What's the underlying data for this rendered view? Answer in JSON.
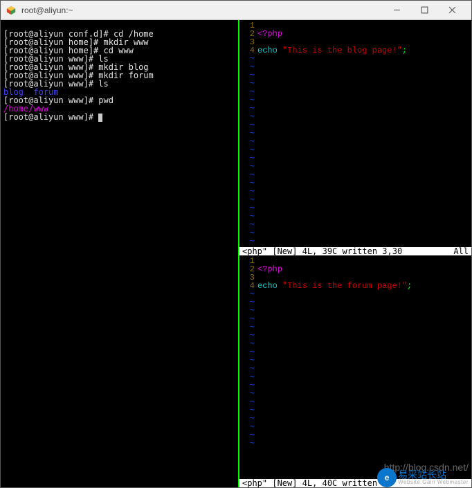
{
  "window": {
    "title": "root@aliyun:~",
    "controls": {
      "minimize": "—",
      "maximize": "☐",
      "close": "✕"
    }
  },
  "shell": {
    "lines": [
      {
        "prompt": "[root@aliyun conf.d]# ",
        "cmd": "cd /home"
      },
      {
        "prompt": "[root@aliyun home]# ",
        "cmd": "mkdir www"
      },
      {
        "prompt": "[root@aliyun home]# ",
        "cmd": "cd www"
      },
      {
        "prompt": "[root@aliyun www]# ",
        "cmd": "ls"
      },
      {
        "prompt": "[root@aliyun www]# ",
        "cmd": "mkdir blog"
      },
      {
        "prompt": "[root@aliyun www]# ",
        "cmd": "mkdir forum"
      },
      {
        "prompt": "[root@aliyun www]# ",
        "cmd": "ls"
      }
    ],
    "ls_out": {
      "a": "blog",
      "gap": "  ",
      "b": "forum"
    },
    "after": [
      {
        "prompt": "[root@aliyun www]# ",
        "cmd": "pwd"
      }
    ],
    "pwd_out": "/home/www",
    "final_prompt": "[root@aliyun www]# "
  },
  "editor_top": {
    "lines": {
      "l1": "<?php",
      "l3_echo": "echo ",
      "l3_str": "\"This is the blog page!\"",
      "l3_semi": ";"
    },
    "status_left": "<php\" [New] 4L, 39C written 3,30",
    "status_right": "All"
  },
  "editor_bot": {
    "lines": {
      "l1": "<?php",
      "l3_echo": "echo ",
      "l3_str": "\"This is the forum page!\"",
      "l3_semi": ";"
    },
    "watermark": "http://blog.csdn.net/",
    "status_left": "<php\" [New] 4L, 40C written 4"
  },
  "gutter": {
    "n1": "1",
    "n2": "2",
    "n3": "3",
    "n4": "4",
    "tilde": "~"
  },
  "logo": {
    "glyph": "e",
    "text": "易采站长站",
    "sub": "Website Gain Webmaster"
  }
}
